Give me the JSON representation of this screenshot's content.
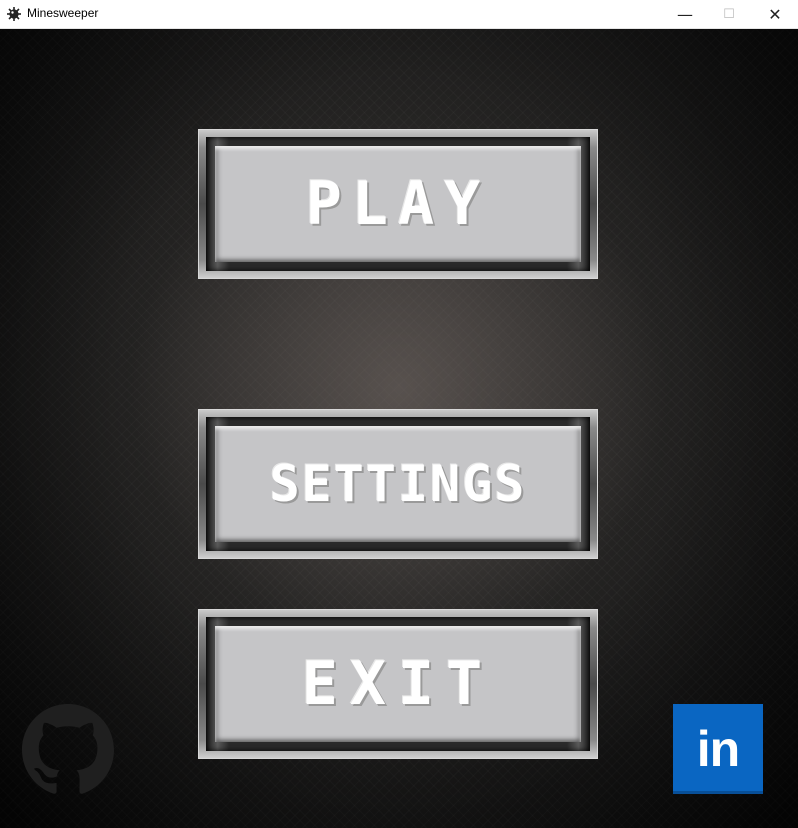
{
  "window": {
    "title": "Minesweeper",
    "icon": "mine-icon",
    "controls": {
      "minimize": "—",
      "maximize": "☐",
      "close": "✕"
    }
  },
  "menu": {
    "play_label": "PLAY",
    "settings_label": "SETTINGS",
    "exit_label": "EXIT"
  },
  "links": {
    "github_icon": "github-icon",
    "linkedin_icon": "linkedin-icon",
    "linkedin_text": "in",
    "linkedin_color": "#0a66c2"
  }
}
